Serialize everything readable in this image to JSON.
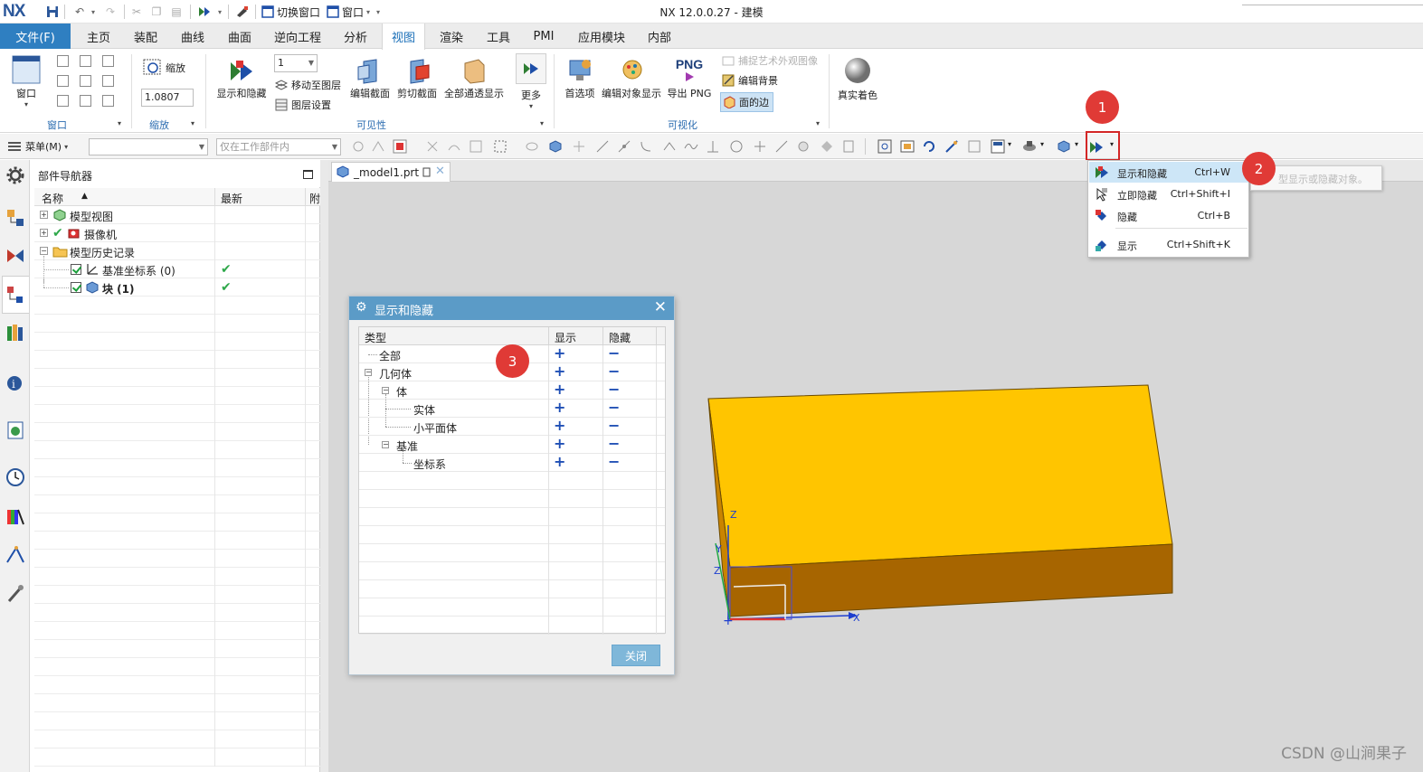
{
  "app": {
    "logo": "NX",
    "title": "NX 12.0.0.27 - 建模",
    "quick_access": {
      "switch_window": "切换窗口",
      "window": "窗口"
    }
  },
  "menu_tabs": [
    {
      "label": "文件(F)"
    },
    {
      "label": "主页"
    },
    {
      "label": "装配"
    },
    {
      "label": "曲线"
    },
    {
      "label": "曲面"
    },
    {
      "label": "逆向工程"
    },
    {
      "label": "分析"
    },
    {
      "label": "视图",
      "active": true
    },
    {
      "label": "渲染"
    },
    {
      "label": "工具"
    },
    {
      "label": "PMI"
    },
    {
      "label": "应用模块"
    },
    {
      "label": "内部"
    }
  ],
  "ribbon": {
    "window_btn": "窗口",
    "zoom_btn": "缩放",
    "zoom_value": "1.0807",
    "show_hide": "显示和隐藏",
    "layer_value": "1",
    "move_to_layer": "移动至图层",
    "layer_settings": "图层设置",
    "edit_section": "编辑截面",
    "clip_section": "剪切截面",
    "all_transparent": "全部通透显示",
    "more": "更多",
    "preferences": "首选项",
    "edit_object_display": "编辑对象显示",
    "export_png": "导出 PNG",
    "png_label": "PNG",
    "capture_image": "捕捉艺术外观图像",
    "edit_background": "编辑背景",
    "face_edges": "面的边",
    "true_shading": "真实着色",
    "groups": {
      "window": "窗口",
      "zoom": "缩放",
      "visibility": "可见性",
      "visualization": "可视化"
    }
  },
  "toolbar": {
    "menu": "菜单(M)",
    "filter_placeholder": "",
    "scope": "仅在工作部件内"
  },
  "navigator": {
    "title": "部件导航器",
    "col_name": "名称",
    "col_latest": "最新",
    "col_extra": "附",
    "rows": [
      {
        "label": "模型视图"
      },
      {
        "label": "摄像机"
      },
      {
        "label": "模型历史记录"
      },
      {
        "label": "基准坐标系 (0)"
      },
      {
        "label": "块 (1)"
      }
    ]
  },
  "graphics": {
    "tab_label": "_model1.prt",
    "colors": {
      "top_face": "#ffc500",
      "side_face": "#a76500",
      "background": "#d7d7d7"
    },
    "axes": {
      "z": "Z",
      "y": "Y",
      "x": "X"
    }
  },
  "dialog": {
    "title": "显示和隐藏",
    "col_type": "类型",
    "col_show": "显示",
    "col_hide": "隐藏",
    "rows": [
      {
        "label": "全部"
      },
      {
        "label": "几何体"
      },
      {
        "label": "体"
      },
      {
        "label": "实体"
      },
      {
        "label": "小平面体"
      },
      {
        "label": "基准"
      },
      {
        "label": "坐标系"
      }
    ],
    "close_btn": "关闭"
  },
  "popup_menu": {
    "items": [
      {
        "label": "显示和隐藏",
        "shortcut": "Ctrl+W"
      },
      {
        "label": "立即隐藏",
        "shortcut": "Ctrl+Shift+I"
      },
      {
        "label": "隐藏",
        "shortcut": "Ctrl+B"
      },
      {
        "label": "显示",
        "shortcut": "Ctrl+Shift+K"
      }
    ],
    "tooltip": "型显示或隐藏对象。"
  },
  "callouts": [
    "1",
    "2",
    "3"
  ],
  "watermark": "CSDN @山涧果子"
}
